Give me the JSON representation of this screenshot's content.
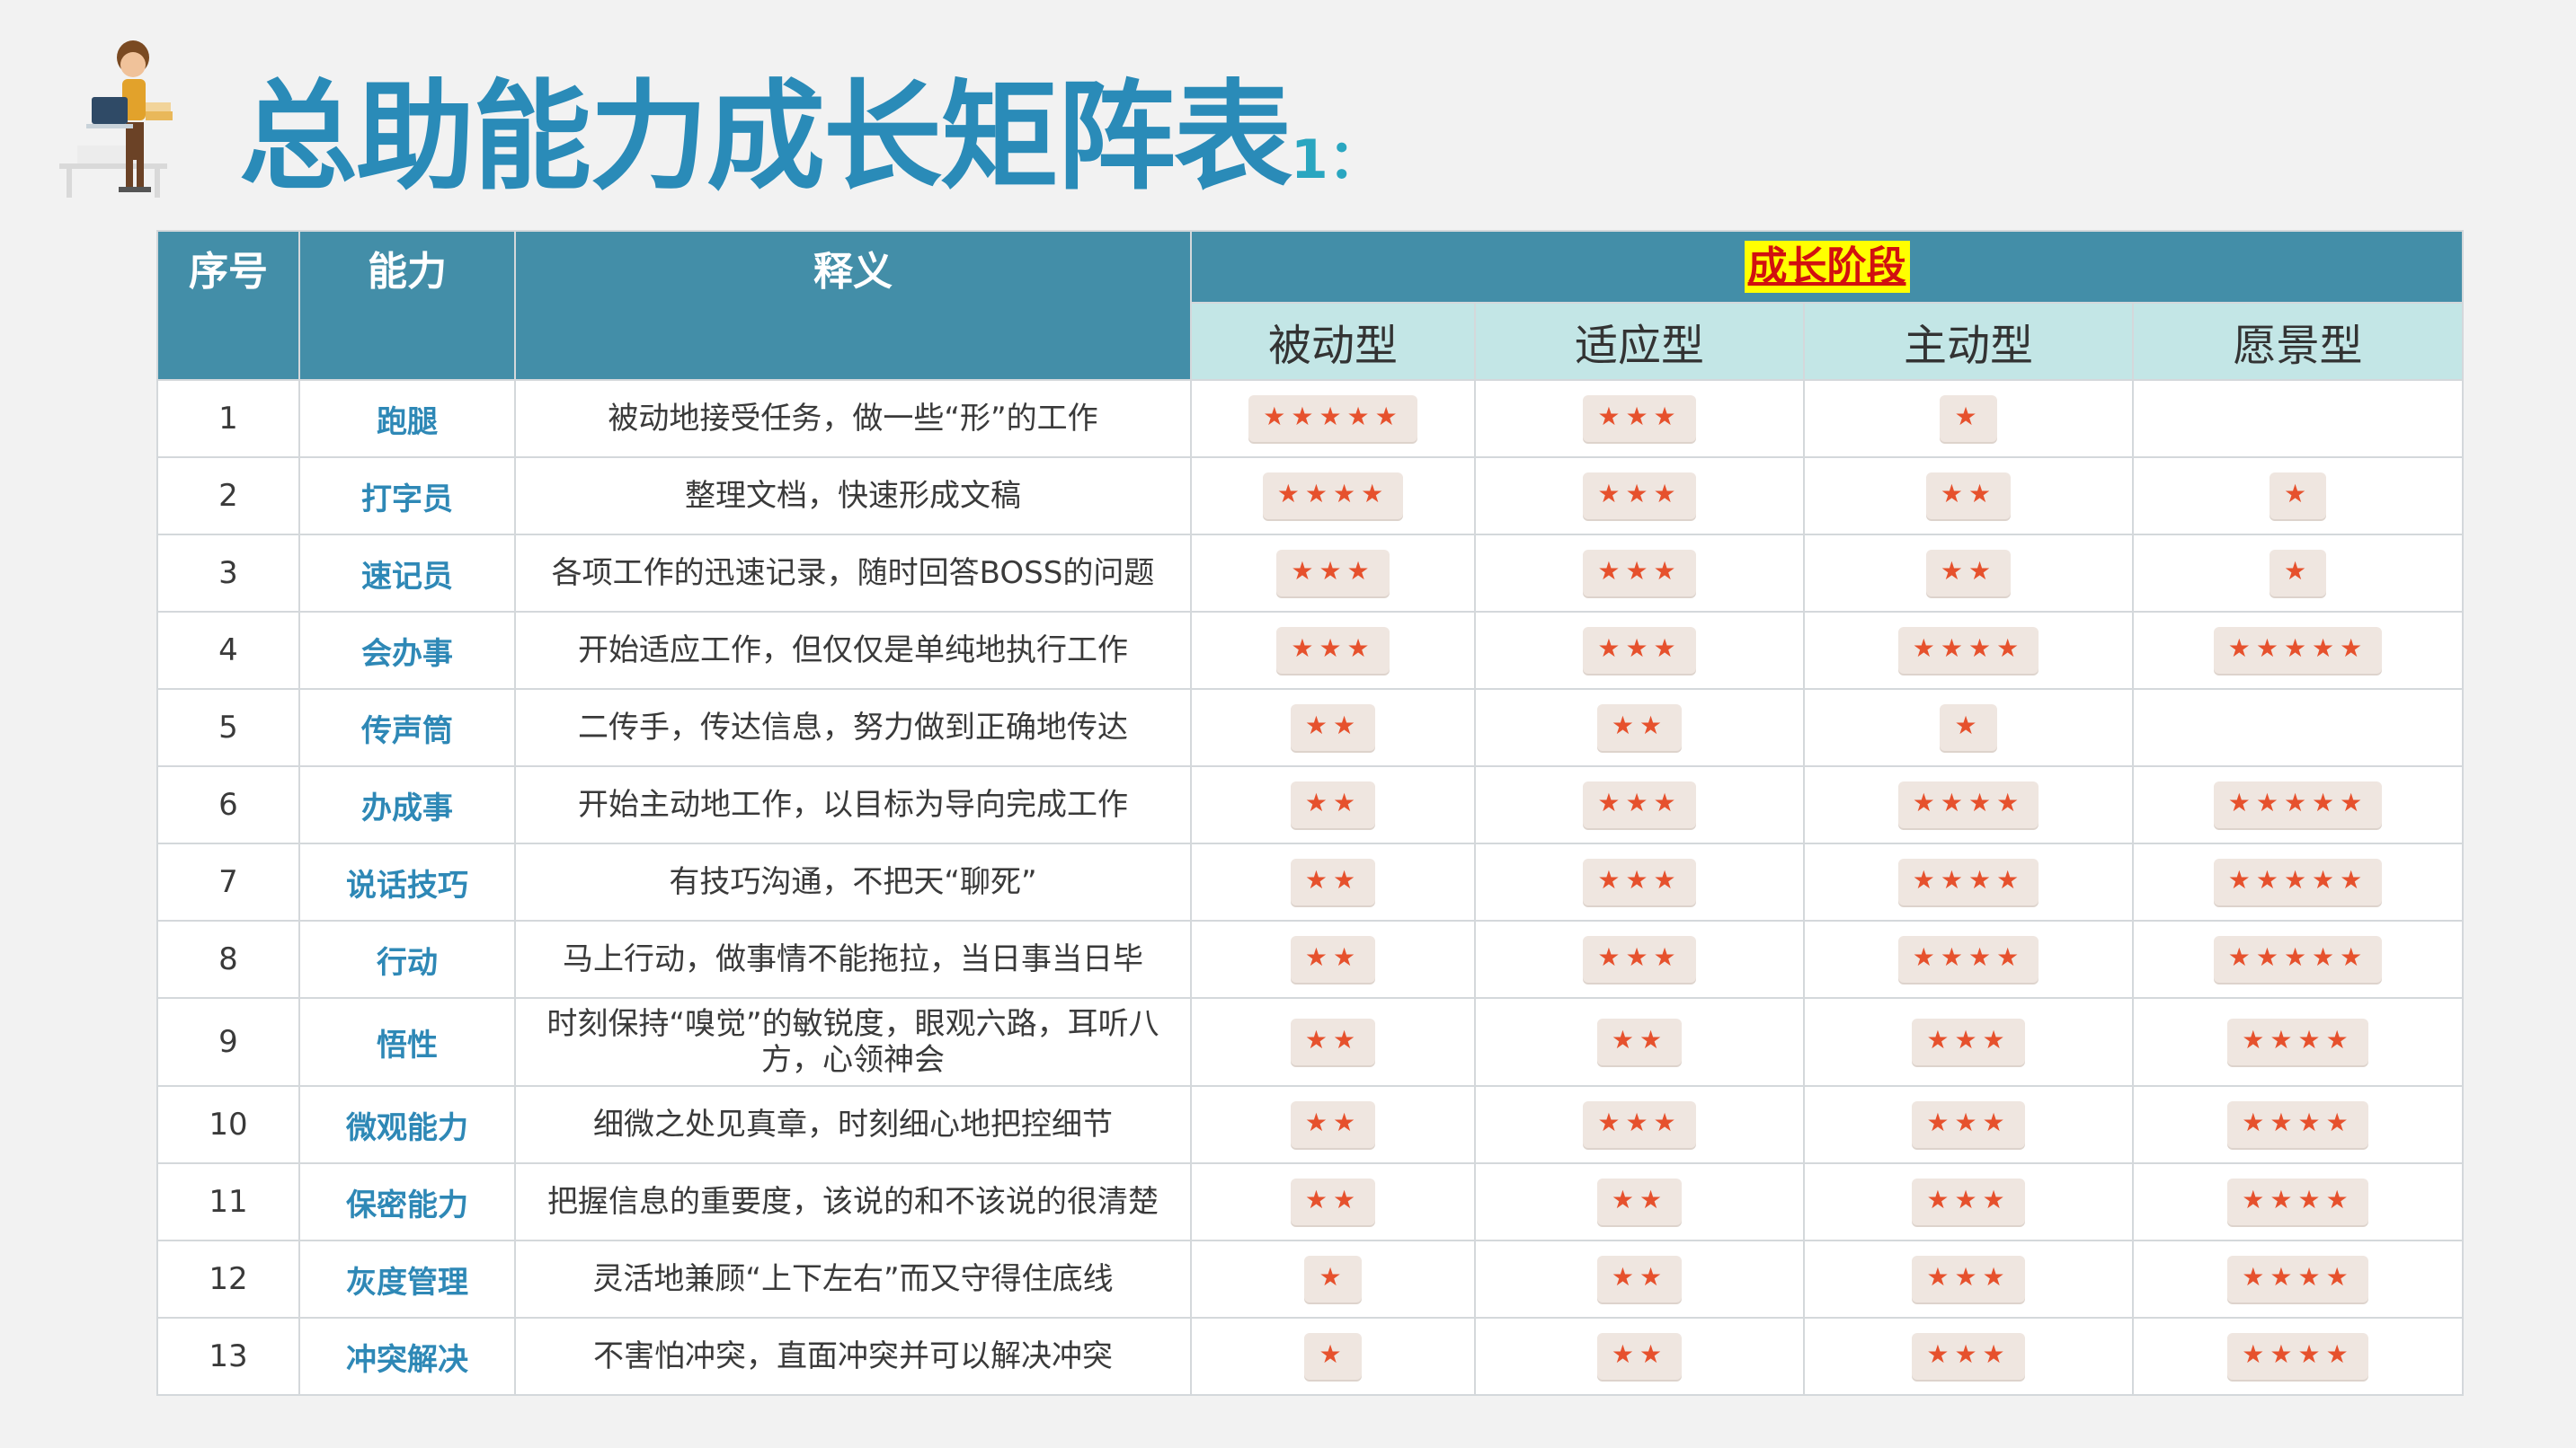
{
  "title": {
    "main": "总助能力成长矩阵表",
    "suffix": "1："
  },
  "headers": {
    "index": "序号",
    "ability": "能力",
    "meaning": "释义",
    "stage": "成长阶段"
  },
  "stages": [
    "被动型",
    "适应型",
    "主动型",
    "愿景型"
  ],
  "star_glyph": "★",
  "rows": [
    {
      "num": "1",
      "ability": "跑腿",
      "desc": "被动地接受任务，做一些“形”的工作",
      "ratings": [
        5,
        3,
        1,
        0
      ]
    },
    {
      "num": "2",
      "ability": "打字员",
      "desc": "整理文档，快速形成文稿",
      "ratings": [
        4,
        3,
        2,
        1
      ]
    },
    {
      "num": "3",
      "ability": "速记员",
      "desc": "各项工作的迅速记录，随时回答BOSS的问题",
      "ratings": [
        3,
        3,
        2,
        1
      ]
    },
    {
      "num": "4",
      "ability": "会办事",
      "desc": "开始适应工作，但仅仅是单纯地执行工作",
      "ratings": [
        3,
        3,
        4,
        5
      ]
    },
    {
      "num": "5",
      "ability": "传声筒",
      "desc": "二传手，传达信息，努力做到正确地传达",
      "ratings": [
        2,
        2,
        1,
        0
      ]
    },
    {
      "num": "6",
      "ability": "办成事",
      "desc": "开始主动地工作，以目标为导向完成工作",
      "ratings": [
        2,
        3,
        4,
        5
      ]
    },
    {
      "num": "7",
      "ability": "说话技巧",
      "desc": "有技巧沟通，不把天“聊死”",
      "ratings": [
        2,
        3,
        4,
        5
      ]
    },
    {
      "num": "8",
      "ability": "行动",
      "desc": "马上行动，做事情不能拖拉，当日事当日毕",
      "ratings": [
        2,
        3,
        4,
        5
      ]
    },
    {
      "num": "9",
      "ability": "悟性",
      "desc": "时刻保持“嗅觉”的敏锐度，眼观六路，耳听八方，心领神会",
      "ratings": [
        2,
        2,
        3,
        4
      ]
    },
    {
      "num": "10",
      "ability": "微观能力",
      "desc": "细微之处见真章，时刻细心地把控细节",
      "ratings": [
        2,
        3,
        3,
        4
      ]
    },
    {
      "num": "11",
      "ability": "保密能力",
      "desc": "把握信息的重要度，该说的和不该说的很清楚",
      "ratings": [
        2,
        2,
        3,
        4
      ]
    },
    {
      "num": "12",
      "ability": "灰度管理",
      "desc": "灵活地兼顾“上下左右”而又守得住底线",
      "ratings": [
        1,
        2,
        3,
        4
      ]
    },
    {
      "num": "13",
      "ability": "冲突解决",
      "desc": "不害怕冲突，直面冲突并可以解决冲突",
      "ratings": [
        1,
        2,
        3,
        4
      ]
    }
  ]
}
